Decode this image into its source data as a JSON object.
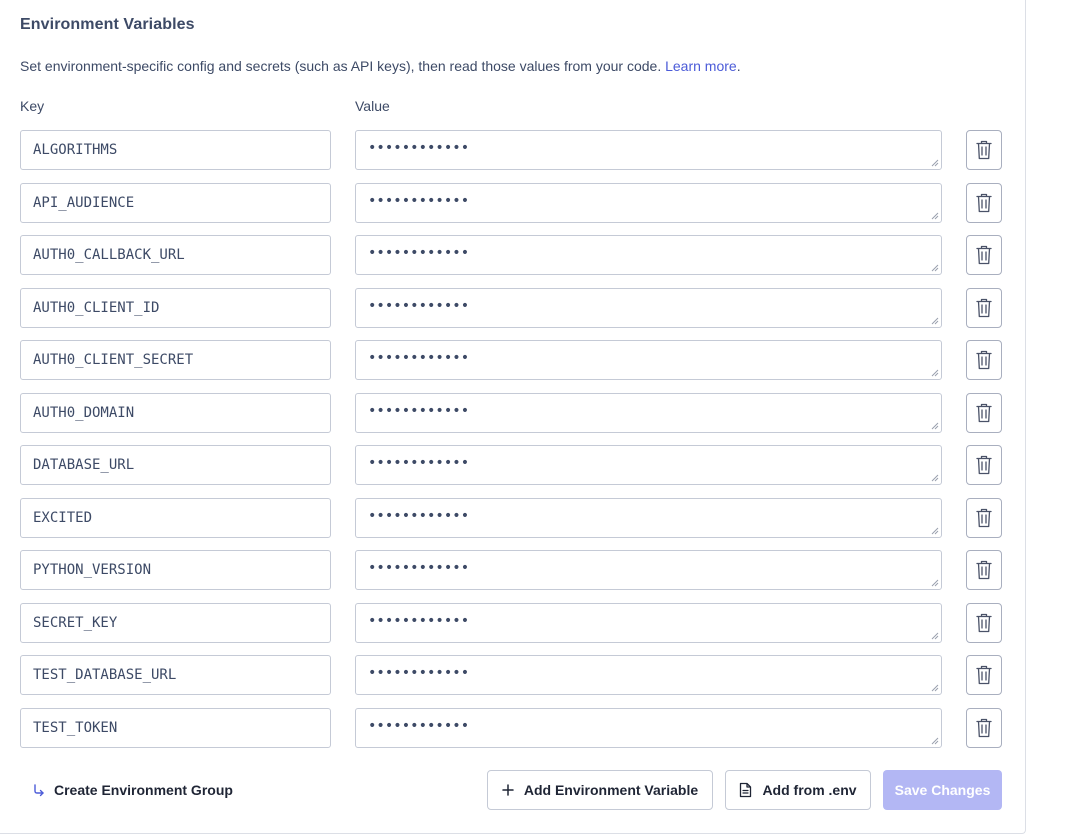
{
  "section": {
    "title": "Environment Variables",
    "description": "Set environment-specific config and secrets (such as API keys), then read those values from your code.",
    "learn_more": "Learn more",
    "period": "."
  },
  "columns": {
    "key": "Key",
    "value": "Value"
  },
  "variables": [
    {
      "key": "ALGORITHMS",
      "value_masked": "••••••••••••"
    },
    {
      "key": "API_AUDIENCE",
      "value_masked": "••••••••••••"
    },
    {
      "key": "AUTH0_CALLBACK_URL",
      "value_masked": "••••••••••••"
    },
    {
      "key": "AUTH0_CLIENT_ID",
      "value_masked": "••••••••••••"
    },
    {
      "key": "AUTH0_CLIENT_SECRET",
      "value_masked": "••••••••••••"
    },
    {
      "key": "AUTH0_DOMAIN",
      "value_masked": "••••••••••••"
    },
    {
      "key": "DATABASE_URL",
      "value_masked": "••••••••••••"
    },
    {
      "key": "EXCITED",
      "value_masked": "••••••••••••"
    },
    {
      "key": "PYTHON_VERSION",
      "value_masked": "••••••••••••"
    },
    {
      "key": "SECRET_KEY",
      "value_masked": "••••••••••••"
    },
    {
      "key": "TEST_DATABASE_URL",
      "value_masked": "••••••••••••"
    },
    {
      "key": "TEST_TOKEN",
      "value_masked": "••••••••••••"
    }
  ],
  "footer": {
    "create_group": "Create Environment Group",
    "create_group_icon": "arrow-return-icon",
    "add_variable": "Add Environment Variable",
    "add_variable_icon": "plus-icon",
    "add_from_env": "Add from .env",
    "add_from_env_icon": "document-icon",
    "save": "Save Changes"
  },
  "colors": {
    "accent": "#4b5bd8",
    "save_disabled": "#b3b7f4",
    "border": "#c5cad6",
    "text": "#3d4a66"
  }
}
